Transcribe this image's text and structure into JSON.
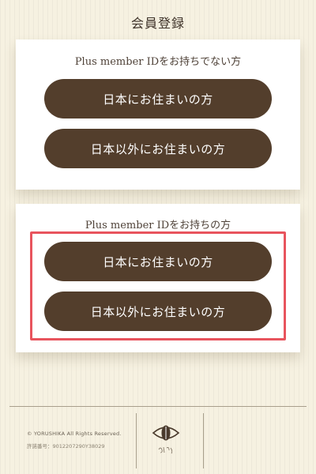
{
  "page": {
    "title": "会員登録"
  },
  "sections": [
    {
      "heading": "Plus member IDをお持ちでない方",
      "buttons": [
        "日本にお住まいの方",
        "日本以外にお住まいの方"
      ]
    },
    {
      "heading": "Plus member IDをお持ちの方",
      "buttons": [
        "日本にお住まいの方",
        "日本以外にお住まいの方"
      ]
    }
  ],
  "highlight": {
    "color": "#e8545d"
  },
  "footer": {
    "copyright": "© YORUSHIKA All Rights Reserved.",
    "license": "許諾番号：9012207290Y38029",
    "logo_icon": "yorushika-eye-logo",
    "logo_script": "ヨルシカ"
  },
  "colors": {
    "button": "#533e2c",
    "background": "#f6f1e1",
    "card": "#ffffff"
  }
}
